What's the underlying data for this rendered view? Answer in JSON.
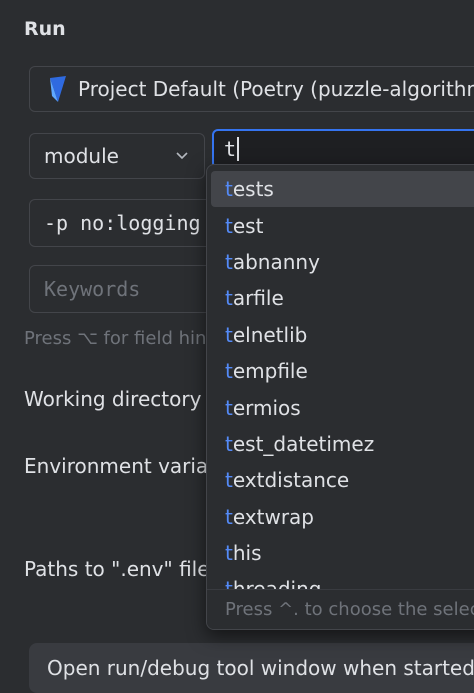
{
  "section": {
    "title": "Run"
  },
  "interpreter": {
    "label": "Project Default (Poetry (puzzle-algorithm",
    "icon": "poetry-icon"
  },
  "run_type": {
    "selected": "module"
  },
  "module_input": {
    "value": "t"
  },
  "params_field": {
    "value": "-p no:logging"
  },
  "keywords_field": {
    "placeholder": "Keywords"
  },
  "hint": {
    "text": "Press ⌥ for field hints"
  },
  "labels": {
    "working_directory": "Working directory",
    "environment_variables": "Environment varia",
    "env_files": "Paths to \".env\" file"
  },
  "bottom_option": {
    "label": "Open run/debug tool window when started"
  },
  "completion": {
    "typed_prefix": "t",
    "selected_index": 0,
    "items": [
      {
        "prefix": "t",
        "rest": "ests"
      },
      {
        "prefix": "t",
        "rest": "est"
      },
      {
        "prefix": "t",
        "rest": "abnanny"
      },
      {
        "prefix": "t",
        "rest": "arfile"
      },
      {
        "prefix": "t",
        "rest": "elnetlib"
      },
      {
        "prefix": "t",
        "rest": "empfile"
      },
      {
        "prefix": "t",
        "rest": "ermios"
      },
      {
        "prefix": "t",
        "rest": "est_datetimez"
      },
      {
        "prefix": "t",
        "rest": "extdistance"
      },
      {
        "prefix": "t",
        "rest": "extwrap"
      },
      {
        "prefix": "t",
        "rest": "his"
      },
      {
        "prefix": "t",
        "rest": "hreading"
      }
    ],
    "footer": "Press ^. to choose the selected item"
  },
  "colors": {
    "accent": "#3574f0",
    "match": "#548af7",
    "background": "#2b2d30"
  }
}
